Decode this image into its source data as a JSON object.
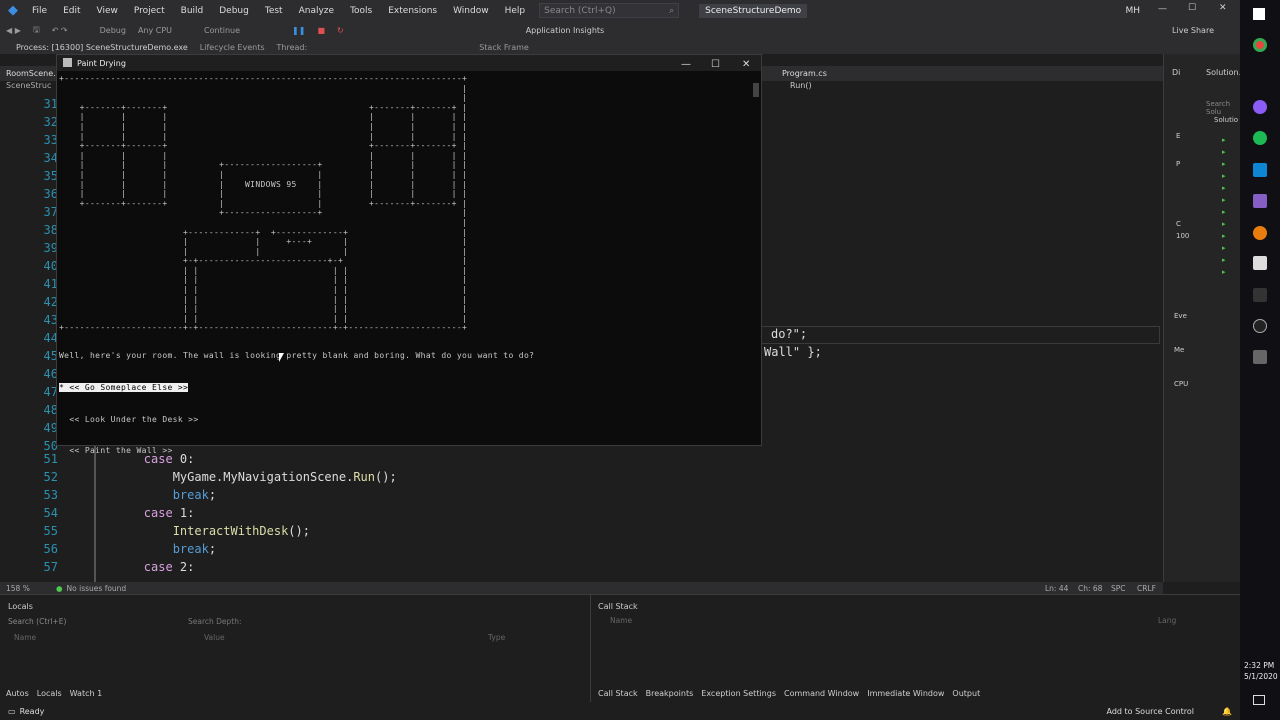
{
  "menu": {
    "items": [
      "File",
      "Edit",
      "View",
      "Project",
      "Build",
      "Debug",
      "Test",
      "Analyze",
      "Tools",
      "Extensions",
      "Window",
      "Help"
    ],
    "search_placeholder": "Search (Ctrl+Q)",
    "solution_name": "SceneStructureDemo",
    "user_initials": "MH"
  },
  "toolbar": {
    "config": "Debug",
    "platform": "Any CPU",
    "continue": "Continue",
    "app_insights": "Application Insights",
    "live_share": "Live Share"
  },
  "procbar": {
    "process": "Process: [16300] SceneStructureDemo.exe",
    "lifecycle": "Lifecycle Events",
    "thread": "Thread:",
    "stack_frame": "Stack Frame"
  },
  "tabs": {
    "left": "RoomScene.cs",
    "left_sub": "SceneStruc",
    "right": "Program.cs",
    "right_member": "Run()"
  },
  "code": {
    "lines_top": [
      "31",
      "32",
      "33",
      "34",
      "35",
      "36",
      "37",
      "38",
      "39",
      "40",
      "41",
      "42",
      "43",
      "44",
      "45",
      "46",
      "47",
      "48",
      "49",
      "50"
    ],
    "peek1": "do?\";",
    "peek2": "Wall\" };",
    "lines": [
      {
        "n": "51",
        "indent": "        ",
        "kw": "case",
        "rest": " 0:"
      },
      {
        "n": "52",
        "indent": "            ",
        "obj": "MyGame.MyNavigationScene.",
        "fn": "Run",
        "rest": "();"
      },
      {
        "n": "53",
        "indent": "            ",
        "kw": "break",
        "rest": ";"
      },
      {
        "n": "54",
        "indent": "        ",
        "kw": "case",
        "rest": " 1:"
      },
      {
        "n": "55",
        "indent": "            ",
        "fn": "InteractWithDesk",
        "rest": "();"
      },
      {
        "n": "56",
        "indent": "            ",
        "kw": "break",
        "rest": ";"
      },
      {
        "n": "57",
        "indent": "        ",
        "kw": "case",
        "rest": " 2:"
      }
    ]
  },
  "console": {
    "title": "Paint Drying",
    "art": "+-----------------------------------------------------------------------------+\n                                                                              |\n                                                                              |\n    +-------+-------+                                       +-------+-------+ |\n    |       |       |                                       |       |       | |\n    |       |       |                                       |       |       | |\n    |       |       |                                       |       |       | |\n    +-------+-------+                                       +-------+-------+ |\n    |       |       |                                       |       |       | |\n    |       |       |          +------------------+         |       |       | |\n    |       |       |          |                  |         |       |       | |\n    |       |       |          |    WINDOWS 95    |         |       |       | |\n    |       |       |          |                  |         |       |       | |\n    +-------+-------+          |                  |         +-------+-------+ |\n                               +------------------+                           |\n                                                                              |\n                        +-------------+  +-------------+                      |\n                        |             |     +---+      |                      |\n                        |             |                |                      |\n                        +-+-------------------------+-+                       |\n                        | |                          | |                      |\n                        | |                          | |                      |\n                        | |                          | |                      |\n                        | |                          | |                      |\n                        | |                          | |                      |\n                        | |                          | |                      |\n+-----------------------+-+--------------------------+-+----------------------+",
    "prompt": "Well, here's your room. The wall is looking pretty blank and boring. What do you want to do?",
    "options": [
      "<< Go Someplace Else >>",
      "<< Look Under the Desk >>",
      "<< Paint the Wall >>"
    ],
    "selected_marker": "*"
  },
  "editor_status": {
    "zoom": "158 %",
    "issues": "No issues found",
    "ln": "Ln: 44",
    "ch": "Ch: 68",
    "spc": "SPC",
    "crlf": "CRLF"
  },
  "locals": {
    "title": "Locals",
    "search_placeholder": "Search (Ctrl+E)",
    "depth": "Search Depth:",
    "cols": [
      "Name",
      "Value",
      "Type"
    ],
    "tabs": [
      "Autos",
      "Locals",
      "Watch 1"
    ]
  },
  "callstack": {
    "title": "Call Stack",
    "cols": [
      "Name",
      "Lang"
    ],
    "tabs": [
      "Call Stack",
      "Breakpoints",
      "Exception Settings",
      "Command Window",
      "Immediate Window",
      "Output"
    ]
  },
  "right_pane": {
    "items": [
      "Di",
      "Solution...",
      "Search Solu",
      "Solutio",
      "E",
      "P",
      "C",
      "100",
      "Eve",
      "Me",
      "CPU"
    ]
  },
  "status": {
    "ready": "Ready",
    "source_control": "Add to Source Control"
  },
  "clock": {
    "time": "2:32 PM",
    "date": "5/1/2020"
  }
}
